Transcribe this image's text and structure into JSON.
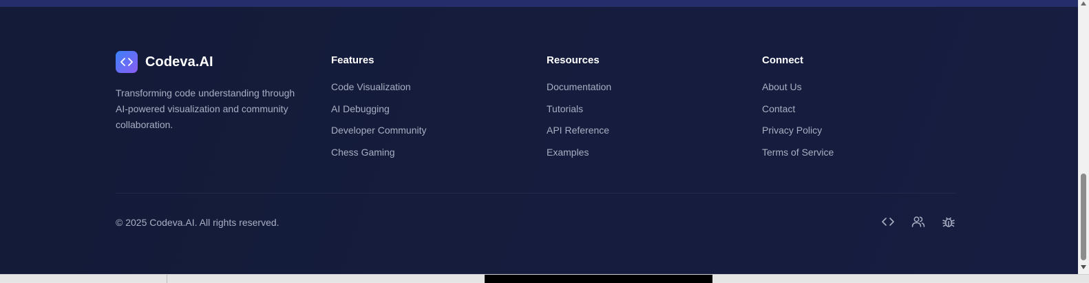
{
  "brand": {
    "name": "Codeva.AI",
    "description": "Transforming code understanding through AI-powered visualization and community collaboration.",
    "logo_icon": "code-brackets-icon",
    "logo_gradient": [
      "#3b82f6",
      "#8b5cf6"
    ]
  },
  "columns": [
    {
      "title": "Features",
      "links": [
        "Code Visualization",
        "AI Debugging",
        "Developer Community",
        "Chess Gaming"
      ]
    },
    {
      "title": "Resources",
      "links": [
        "Documentation",
        "Tutorials",
        "API Reference",
        "Examples"
      ]
    },
    {
      "title": "Connect",
      "links": [
        "About Us",
        "Contact",
        "Privacy Policy",
        "Terms of Service"
      ]
    }
  ],
  "copyright": "© 2025 Codeva.AI. All rights reserved.",
  "social_icons": [
    "code-icon",
    "users-icon",
    "bug-icon"
  ],
  "colors": {
    "background": "#141b38",
    "top_strip": "#252d6b",
    "heading": "#ffffff",
    "link": "#a9afc2"
  }
}
